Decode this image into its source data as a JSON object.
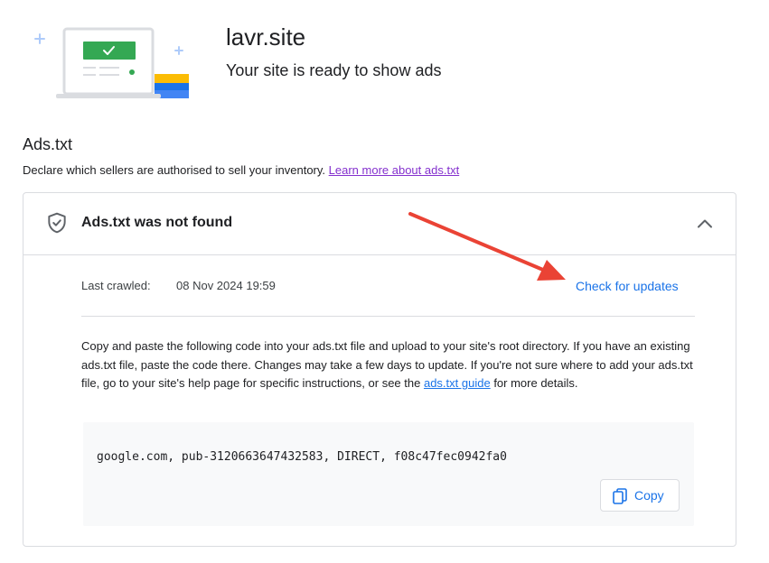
{
  "site": {
    "name": "lavr.site",
    "status": "Your site is ready to show ads"
  },
  "adstxt": {
    "title": "Ads.txt",
    "description": "Declare which sellers are authorised to sell your inventory.",
    "learn_more": "Learn more about ads.txt",
    "card": {
      "title": "Ads.txt was not found",
      "last_crawled_label": "Last crawled:",
      "last_crawled_value": "08 Nov 2024 19:59",
      "check_updates": "Check for updates",
      "instructions_text": "Copy and paste the following code into your ads.txt file and upload to your site's root directory. If you have an existing ads.txt file, paste the code there. Changes may take a few days to update. If you're not sure where to add your ads.txt file, go to your site's help page for specific instructions, or see the",
      "guide_link": "ads.txt guide",
      "instructions_end": "for more details.",
      "code": "google.com, pub-3120663647432583, DIRECT, f08c47fec0942fa0",
      "copy_label": "Copy"
    }
  },
  "icons": {
    "status": "shield-check-icon",
    "collapse": "chevron-up-icon",
    "copy": "copy-icon"
  },
  "colors": {
    "link_blue": "#1a73e8",
    "visited_link": "#8430ce",
    "annotation_arrow": "#ea4335",
    "success_green": "#34a853"
  }
}
